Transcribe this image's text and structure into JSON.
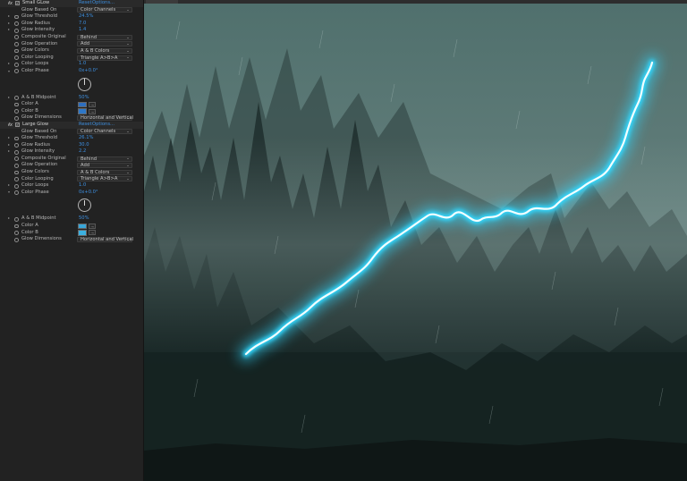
{
  "effects": [
    {
      "name": "Small GLow",
      "reset": "Reset",
      "options": "Options...",
      "glow_based_on": "Color Channels",
      "threshold": "24.5%",
      "radius": "7.0",
      "intensity": "1.4",
      "composite_original": "Behind",
      "operation": "Add",
      "colors": "A & B Colors",
      "looping": "Triangle A>B>A",
      "loops": "1.0",
      "phase": "0x+0.0°",
      "midpoint": "50%",
      "color_a": "#2e6fc0",
      "color_b": "#2e78c8",
      "dimensions": "Horizontal and Vertical"
    },
    {
      "name": "Large Glow",
      "reset": "Reset",
      "options": "Options...",
      "glow_based_on": "Color Channels",
      "threshold": "26.1%",
      "radius": "30.0",
      "intensity": "2.2",
      "composite_original": "Behind",
      "operation": "Add",
      "colors": "A & B Colors",
      "looping": "Triangle A>B>A",
      "loops": "1.0",
      "phase": "0x+0.0°",
      "midpoint": "50%",
      "color_a": "#38a6d8",
      "color_b": "#3cb0e0",
      "dimensions": "Horizontal and Vertical"
    }
  ],
  "labels": {
    "glow_based_on": "Glow Based On",
    "threshold": "Glow Threshold",
    "radius": "Glow Radius",
    "intensity": "Glow Intensity",
    "composite_original": "Composite Original",
    "operation": "Glow Operation",
    "colors": "Glow Colors",
    "looping": "Color Looping",
    "loops": "Color Loops",
    "phase": "Color Phase",
    "midpoint": "A & B Midpoint",
    "color_a": "Color A",
    "color_b": "Color B",
    "dimensions": "Glow Dimensions"
  },
  "icons": {
    "fx_badge": "fx",
    "checkbox": "✓",
    "eyedropper": "eyedropper-icon"
  },
  "viewer": {
    "glow_color": "#30d8ff",
    "glow_core_color": "#f2ffff"
  }
}
